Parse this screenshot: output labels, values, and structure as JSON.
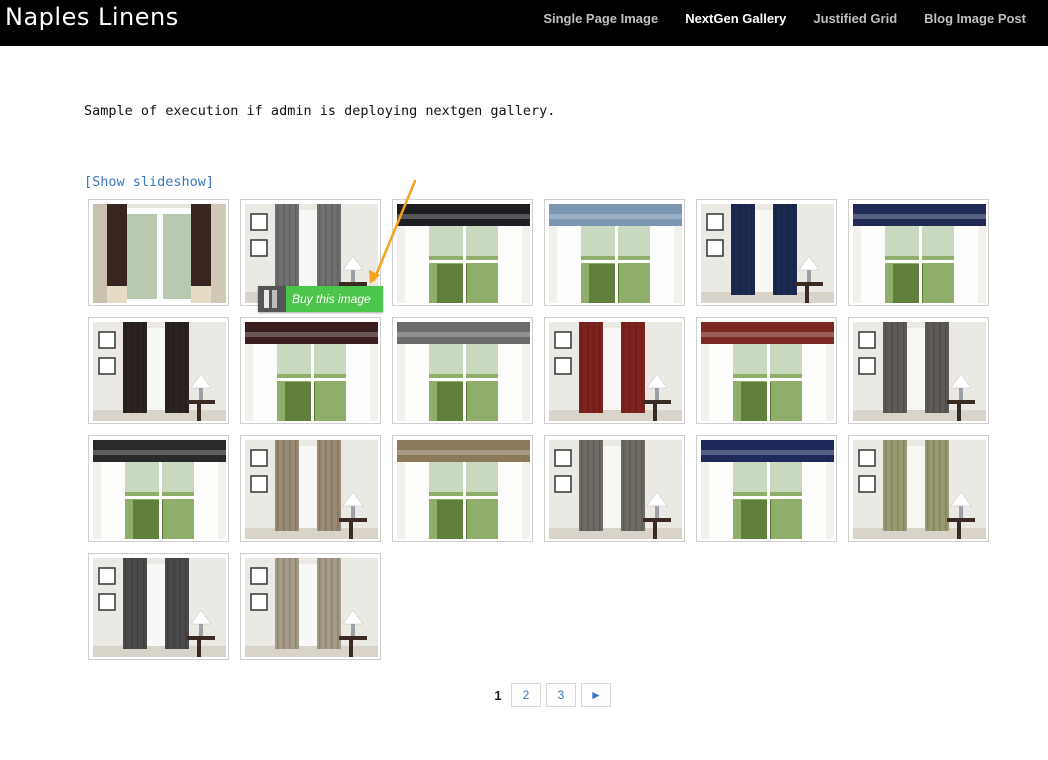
{
  "site": {
    "title": "Naples Linens"
  },
  "nav": {
    "items": [
      {
        "label": "Single Page Image",
        "active": false
      },
      {
        "label": "NextGen Gallery",
        "active": true
      },
      {
        "label": "Justified Grid",
        "active": false
      },
      {
        "label": "Blog Image Post",
        "active": false
      }
    ]
  },
  "content": {
    "intro": "Sample of execution if admin is deploying nextgen gallery.",
    "slideshow_link": "[Show slideshow]"
  },
  "gallery": {
    "thumbnails": [
      {
        "kind": "doors-curtain",
        "color": "#3a2420"
      },
      {
        "kind": "curtain",
        "color": "#707070"
      },
      {
        "kind": "valance",
        "color": "#1e1e22"
      },
      {
        "kind": "valance",
        "color": "#7a96b0"
      },
      {
        "kind": "curtain",
        "color": "#1d2a50"
      },
      {
        "kind": "valance",
        "color": "#1f2a55"
      },
      {
        "kind": "curtain",
        "color": "#2b2320"
      },
      {
        "kind": "valance",
        "color": "#3a1e1e"
      },
      {
        "kind": "valance",
        "color": "#6b6b6b"
      },
      {
        "kind": "curtain",
        "color": "#7d2420"
      },
      {
        "kind": "valance",
        "color": "#7a2a22"
      },
      {
        "kind": "curtain",
        "color": "#5e5a58"
      },
      {
        "kind": "valance",
        "color": "#2a2a2a"
      },
      {
        "kind": "curtain",
        "color": "#9a8a76"
      },
      {
        "kind": "valance",
        "color": "#8a7a5a"
      },
      {
        "kind": "curtain",
        "color": "#6e6a64"
      },
      {
        "kind": "valance",
        "color": "#1d2a5a"
      },
      {
        "kind": "curtain",
        "color": "#9a9a70"
      },
      {
        "kind": "curtain",
        "color": "#4a4a4a"
      },
      {
        "kind": "curtain",
        "color": "#a69a88"
      }
    ]
  },
  "buy_button": {
    "label": "Buy this image",
    "color": "#4cc64a"
  },
  "pagination": {
    "current": "1",
    "pages": [
      "2",
      "3"
    ],
    "next": "►"
  },
  "annotation": {
    "arrow_color": "#f5a21c"
  }
}
